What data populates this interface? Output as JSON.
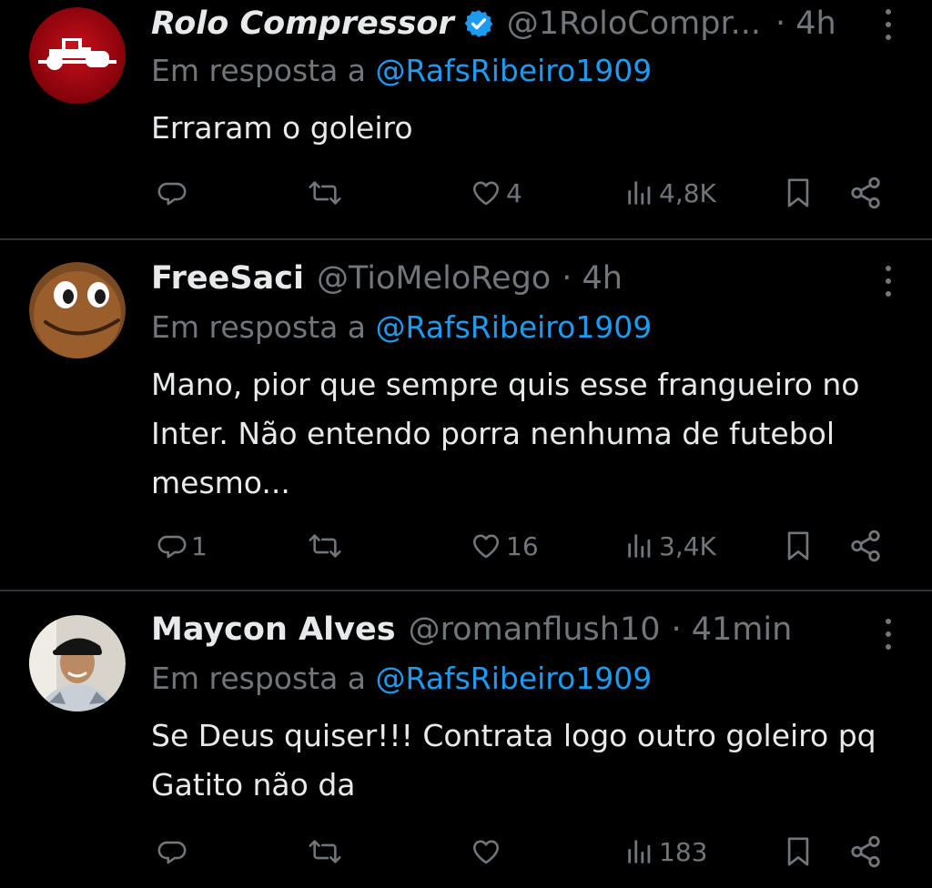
{
  "colors": {
    "background": "#000000",
    "text": "#e7e9ea",
    "muted": "#71767b",
    "accent": "#1d9bf0",
    "divider": "#2f3336"
  },
  "icons": {
    "reply": "speech-bubble-icon",
    "retweet": "retweet-arrows-icon",
    "like": "heart-icon",
    "views": "bar-chart-icon",
    "bookmark": "bookmark-icon",
    "share": "share-nodes-icon",
    "more": "vertical-dots-icon",
    "verified": "verified-badge-icon"
  },
  "tweets": [
    {
      "name": "Rolo Compressor",
      "handle": "@1RoloCompr...",
      "time": "· 4h",
      "verified": true,
      "reply_prefix": "Em resposta a ",
      "reply_to": "@RafsRibeiro1909",
      "text": "Erraram o goleiro",
      "replies": "",
      "likes": "4",
      "views": "4,8K"
    },
    {
      "name": "FreeSaci",
      "handle": "@TioMeloRego",
      "time": "· 4h",
      "verified": false,
      "reply_prefix": "Em resposta a ",
      "reply_to": "@RafsRibeiro1909",
      "text": "Mano, pior que sempre quis esse frangueiro no Inter. Não entendo porra nenhuma de futebol mesmo...",
      "replies": "1",
      "likes": "16",
      "views": "3,4K"
    },
    {
      "name": "Maycon Alves",
      "handle": "@romanflush10",
      "time": "· 41min",
      "verified": false,
      "reply_prefix": "Em resposta a ",
      "reply_to": "@RafsRibeiro1909",
      "text": "Se Deus quiser!!! Contrata logo outro goleiro pq Gatito não da",
      "replies": "",
      "likes": "",
      "views": "183"
    }
  ]
}
